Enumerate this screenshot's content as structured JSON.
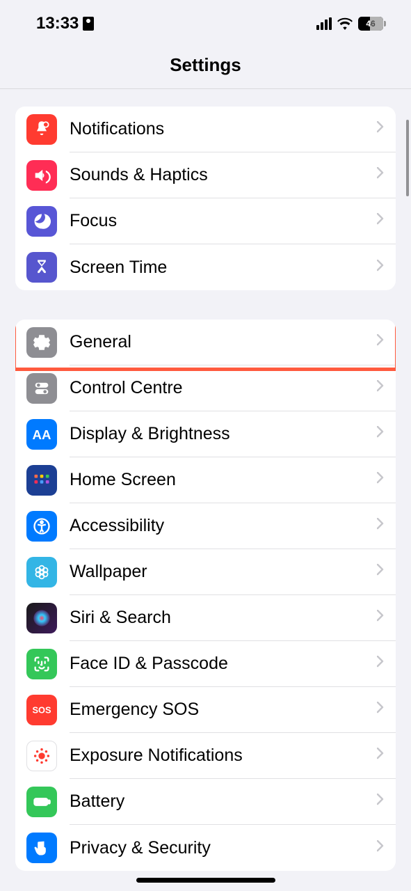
{
  "status": {
    "time": "13:33",
    "battery": "46"
  },
  "page": {
    "title": "Settings"
  },
  "groups": [
    {
      "items": [
        {
          "id": "notifications",
          "label": "Notifications",
          "icon": "notifications"
        },
        {
          "id": "sounds",
          "label": "Sounds & Haptics",
          "icon": "sounds"
        },
        {
          "id": "focus",
          "label": "Focus",
          "icon": "focus"
        },
        {
          "id": "screentime",
          "label": "Screen Time",
          "icon": "screentime"
        }
      ]
    },
    {
      "items": [
        {
          "id": "general",
          "label": "General",
          "icon": "general",
          "highlighted": true
        },
        {
          "id": "control",
          "label": "Control Centre",
          "icon": "control"
        },
        {
          "id": "display",
          "label": "Display & Brightness",
          "icon": "display"
        },
        {
          "id": "homescreen",
          "label": "Home Screen",
          "icon": "homescreen"
        },
        {
          "id": "accessibility",
          "label": "Accessibility",
          "icon": "accessibility"
        },
        {
          "id": "wallpaper",
          "label": "Wallpaper",
          "icon": "wallpaper"
        },
        {
          "id": "siri",
          "label": "Siri & Search",
          "icon": "siri"
        },
        {
          "id": "faceid",
          "label": "Face ID & Passcode",
          "icon": "faceid"
        },
        {
          "id": "sos",
          "label": "Emergency SOS",
          "icon": "sos"
        },
        {
          "id": "exposure",
          "label": "Exposure Notifications",
          "icon": "exposure"
        },
        {
          "id": "battery",
          "label": "Battery",
          "icon": "battery"
        },
        {
          "id": "privacy",
          "label": "Privacy & Security",
          "icon": "privacy"
        }
      ]
    }
  ]
}
